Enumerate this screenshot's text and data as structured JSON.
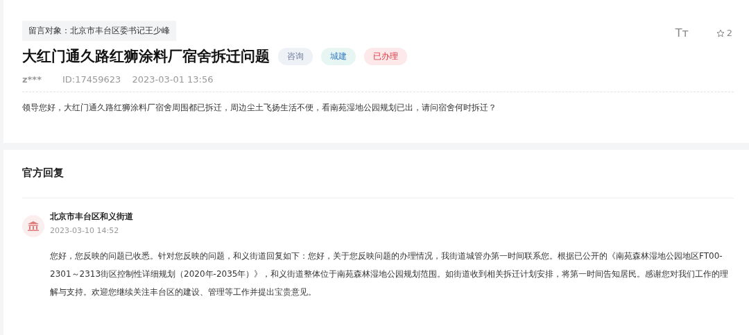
{
  "question": {
    "target": "留言对象：北京市丰台区委书记王少峰",
    "title": "大红门通久路红狮涂料厂宿舍拆迁问题",
    "tags": [
      {
        "label": "咨询",
        "kind": "type",
        "color": "#eef1f6"
      },
      {
        "label": "城建",
        "kind": "field",
        "color": "#e8f6f3"
      },
      {
        "label": "已办理",
        "kind": "status",
        "color": "#fde8ea"
      }
    ],
    "font_toggle": "Tт",
    "star_count": "2",
    "user": "z***",
    "id": "ID:17459623",
    "time": "2023-03-01 13:56",
    "body": "领导您好，大红门通久路红狮涂料厂宿舍周围都已拆迁，周边尘土飞扬生活不便，看南苑湿地公园规划已出，请问宿舍何时拆迁？"
  },
  "reply": {
    "heading": "官方回复",
    "org": "北京市丰台区和义街道",
    "time": "2023-03-10 14:52",
    "body": "您好，您反映的问题已收悉。针对您反映的问题，和义街道回复如下：您好，关于您反映问题的办理情况，我街道城管办第一时间联系您。根据已公开的《南苑森林湿地公园地区FT00-2301～2313街区控制性详细规划（2020年-2035年）》，和义街道整体位于南苑森林湿地公园规划范围。如街道收到相关拆迁计划安排，将第一时间告知居民。感谢您对我们工作的理解与支持。欢迎您继续关注丰台区的建设、管理等工作并提出宝贵意见。"
  }
}
